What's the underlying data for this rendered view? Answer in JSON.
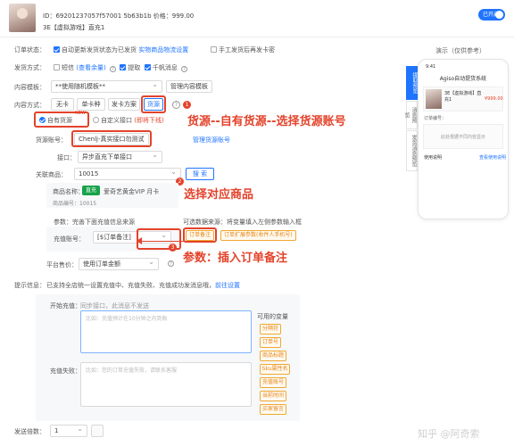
{
  "header": {
    "id_line": "ID：69201237057f57001 5b63b1b   价格：999.00",
    "name_line": "3E【虚拟游戏】直充1",
    "toggle_label": "已开启"
  },
  "order_status": {
    "label": "订单状态：",
    "opt1": "自动更新发货状态为已发货",
    "opt1_link": "实物商品物流设置",
    "opt2": "手工发货后再发卡密"
  },
  "ship_method": {
    "label": "发货方式：",
    "sms": "短信",
    "sms_link": "(查看余量)",
    "pickup": "提取",
    "app_msg": "千帆消息"
  },
  "content_tpl": {
    "label": "内容模板：",
    "value": "**使用随机模板**",
    "manage_btn": "管理内容模板"
  },
  "content_method": {
    "label": "内容方式：",
    "tabs": [
      "无卡",
      "单卡种",
      "发卡方案",
      "货源"
    ]
  },
  "source_radio": {
    "own": "自有货源",
    "new_badge": "NEW",
    "custom": "自定义接口",
    "offline": "(即将下线)"
  },
  "goods_account": {
    "label": "货源账号：",
    "value": "Chenlj-真实接口勿测试",
    "link": "管理货源账号"
  },
  "api": {
    "label": "接口：",
    "value": "异步直充下单接口"
  },
  "related_goods": {
    "label": "关联商品：",
    "value": "10015",
    "search_btn": "搜 索"
  },
  "goods_card": {
    "name_label": "商品名称：",
    "badge": "直充",
    "name": "爱奇艺黄金VIP 月卡",
    "code": "商品编号：10015"
  },
  "params": {
    "title": "参数：完善下面充值信息来源",
    "source_hint": "可选数据来源：将变量填入左侧参数输入框",
    "field_label": "充值账号：",
    "field_value": "[$订单备注]",
    "btn_note": "订单备注",
    "btn_ext": "订单扩展参数(收件人手机号)"
  },
  "platform_price": {
    "label": "平台售价：",
    "value": "使用订单金额"
  },
  "tips": {
    "label": "提示信息：",
    "text": "已支持全店统一设置充值中、充值失败、充值成功发消息哦，",
    "link": "前往设置"
  },
  "charging": {
    "label": "开始充值：",
    "sync_note": "同步接口，此消息不发送",
    "placeholder": "比如：充值预计在10分钟之内到账"
  },
  "failed": {
    "label": "充值失败：",
    "placeholder": "比如：您的订单充值失败，请联系客服"
  },
  "variables": {
    "title": "可用的变量",
    "items": [
      "分隔符",
      "订单号",
      "商品标题",
      "Sku属性名",
      "充值账号",
      "当前时间",
      "买家留言"
    ]
  },
  "ship_count": {
    "label": "发送倍数：",
    "value": "1"
  },
  "annotations": {
    "a1": "货源--自有货源--选择货源账号",
    "a2": "选择对应商品",
    "a3": "参数：插入订单备注",
    "n1": "1",
    "n2": "2",
    "n3": "3"
  },
  "preview": {
    "title": "演示（仅供参考）",
    "side_tabs": [
      "提取预览",
      "消息预览",
      "发货消息预览"
    ],
    "time": "9:41",
    "app_title": "Agiso自动提货系统",
    "product": "3E【虚拟游戏】直充1",
    "price": "¥999.00",
    "order_no_label": "订单编号：",
    "placeholder": "此处根据不同内容显示",
    "usage_label": "使用说明",
    "usage_link": "查看使用说明"
  },
  "watermark": "知乎 @阿奇索",
  "colors": {
    "accent": "#1f74ff",
    "annotation": "#e3432b",
    "tag": "#e6861a"
  }
}
